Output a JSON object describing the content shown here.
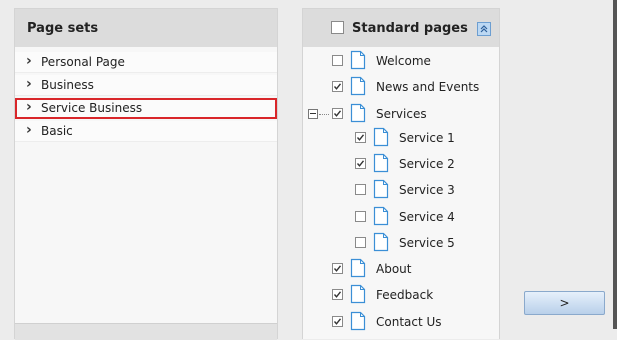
{
  "page_sets": {
    "title": "Page sets",
    "items": [
      {
        "label": "Personal Page"
      },
      {
        "label": "Business"
      },
      {
        "label": "Service Business",
        "selected": true
      },
      {
        "label": "Basic"
      }
    ]
  },
  "standard_pages": {
    "title": "Standard pages",
    "header_checked": false,
    "items": [
      {
        "label": "Welcome",
        "checked": false
      },
      {
        "label": "News and Events",
        "checked": true
      },
      {
        "label": "Services",
        "checked": true,
        "expanded": true
      },
      {
        "label": "Service 1",
        "checked": true
      },
      {
        "label": "Service 2",
        "checked": true
      },
      {
        "label": "Service 3",
        "checked": false
      },
      {
        "label": "Service 4",
        "checked": false
      },
      {
        "label": "Service 5",
        "checked": false
      },
      {
        "label": "About",
        "checked": true
      },
      {
        "label": "Feedback",
        "checked": true
      },
      {
        "label": "Contact Us",
        "checked": true
      }
    ]
  },
  "nav": {
    "next_label": ">"
  },
  "colors": {
    "selection_outline": "#d9262a",
    "accent_blue": "#6c9ed1"
  }
}
